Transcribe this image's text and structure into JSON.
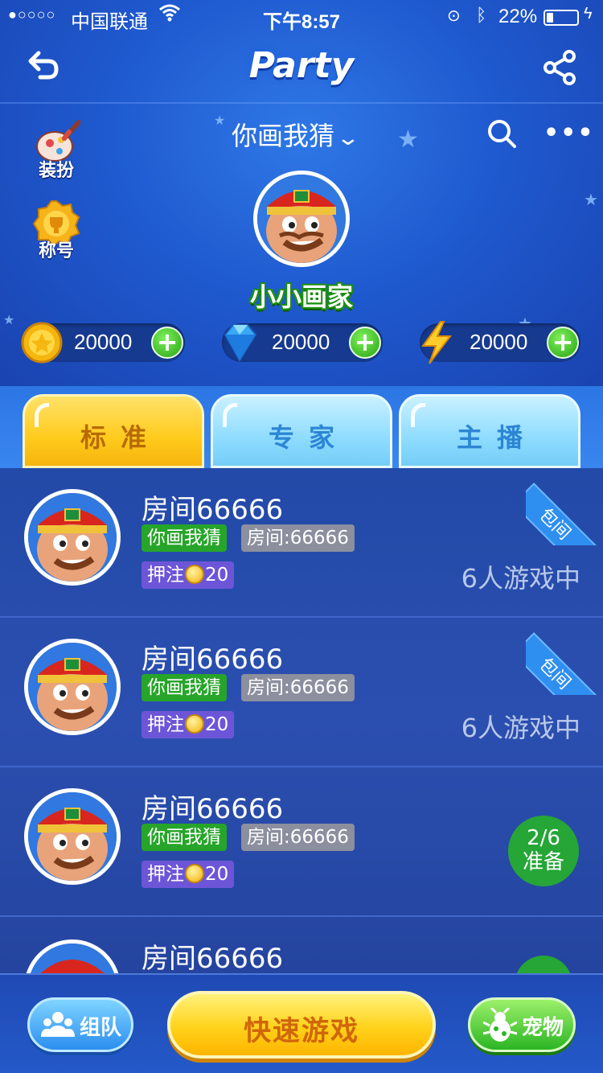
{
  "status_bar": {
    "signal": "●○○○○",
    "carrier": "中国联通",
    "time": "下午8:57",
    "battery_pct": "22%",
    "battery_level": 0.22
  },
  "nav": {
    "title": "Party"
  },
  "side_buttons": {
    "dress_up": "装扮",
    "titles": "称号"
  },
  "game_select": {
    "selected": "你画我猜"
  },
  "profile": {
    "nickname": "小小画家"
  },
  "currencies": [
    {
      "type": "coin",
      "value": "20000"
    },
    {
      "type": "diamond",
      "value": "20000"
    },
    {
      "type": "energy",
      "value": "20000"
    }
  ],
  "tabs": [
    {
      "label": "标准",
      "active": true
    },
    {
      "label": "专家",
      "active": false
    },
    {
      "label": "主播",
      "active": false
    }
  ],
  "rooms": [
    {
      "name": "房间66666",
      "game": "你画我猜",
      "room_id": "房间:66666",
      "bet_label": "押注",
      "bet": "20",
      "status": "6人游戏中",
      "private": "包间"
    },
    {
      "name": "房间66666",
      "game": "你画我猜",
      "room_id": "房间:66666",
      "bet_label": "押注",
      "bet": "20",
      "status": "6人游戏中",
      "private": "包间"
    },
    {
      "name": "房间66666",
      "game": "你画我猜",
      "room_id": "房间:66666",
      "bet_label": "押注",
      "bet": "20",
      "ready_count": "2/6",
      "ready_label": "准备"
    },
    {
      "name": "房间66666"
    }
  ],
  "bottom": {
    "team": "组队",
    "quick_game": "快速游戏",
    "pet": "宠物"
  },
  "colors": {
    "accent_yellow": "#ffcb1c",
    "accent_green": "#27a52a",
    "background_blue": "#1f5ad0"
  }
}
